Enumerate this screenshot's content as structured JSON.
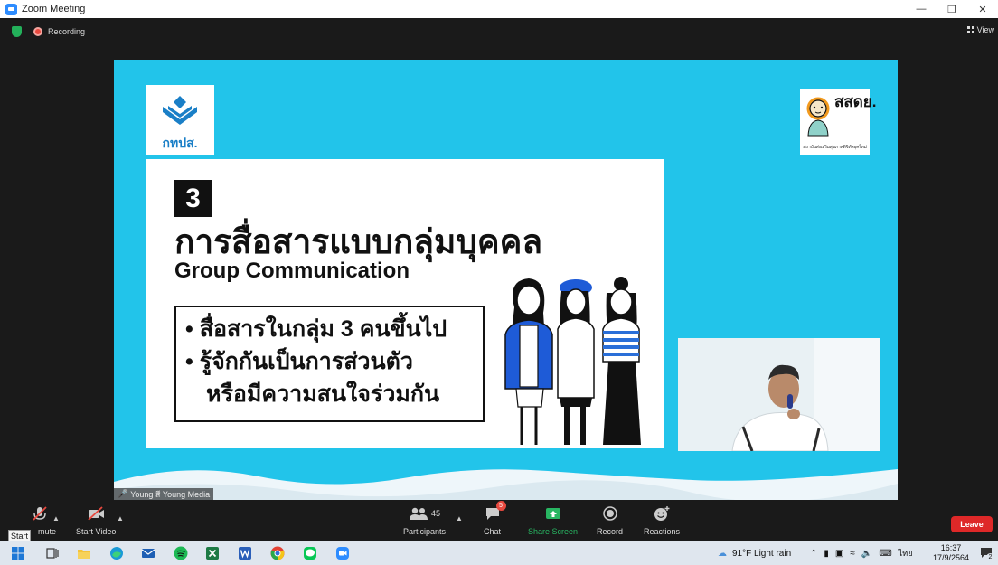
{
  "window": {
    "title": "Zoom Meeting"
  },
  "meeting": {
    "recording_label": "Recording",
    "view_label": "View",
    "participant_name": "Young สี Young Media"
  },
  "slide": {
    "org_name": "กทปส.",
    "partner_short": "สสดย.",
    "partner_tagline": "สถาบันส่งเสริมสุขภาพดิจิทัลยุคใหม่",
    "section_number": "3",
    "title_th": "การสื่อสารแบบกลุ่มบุคคล",
    "title_en": "Group Communication",
    "bullets": [
      "• สื่อสารในกลุ่ม 3 คนขึ้นไป",
      "• รู้จักกันเป็นการส่วนตัว",
      "หรือมีความสนใจร่วมกัน"
    ]
  },
  "controls": {
    "unmute_label": "mute",
    "start_tooltip": "Start",
    "start_video_label": "Start Video",
    "participants_label": "Participants",
    "participants_count": "45",
    "chat_label": "Chat",
    "chat_badge": "5",
    "share_label": "Share Screen",
    "record_label": "Record",
    "reactions_label": "Reactions",
    "leave_label": "Leave"
  },
  "taskbar": {
    "weather": "91°F  Light rain",
    "lang": "ไทย",
    "time": "16:37",
    "date": "17/9/2564",
    "notif_count": "2",
    "apps": [
      "windows-start",
      "task-view",
      "file-explorer",
      "edge",
      "mail",
      "spotify",
      "excel",
      "word",
      "chrome",
      "line",
      "zoom"
    ]
  },
  "colors": {
    "slide_bg": "#22c4ea",
    "share_green": "#28b662",
    "leave_red": "#de2828",
    "recording_red": "#e8493f",
    "org_blue": "#1a7fc7"
  }
}
